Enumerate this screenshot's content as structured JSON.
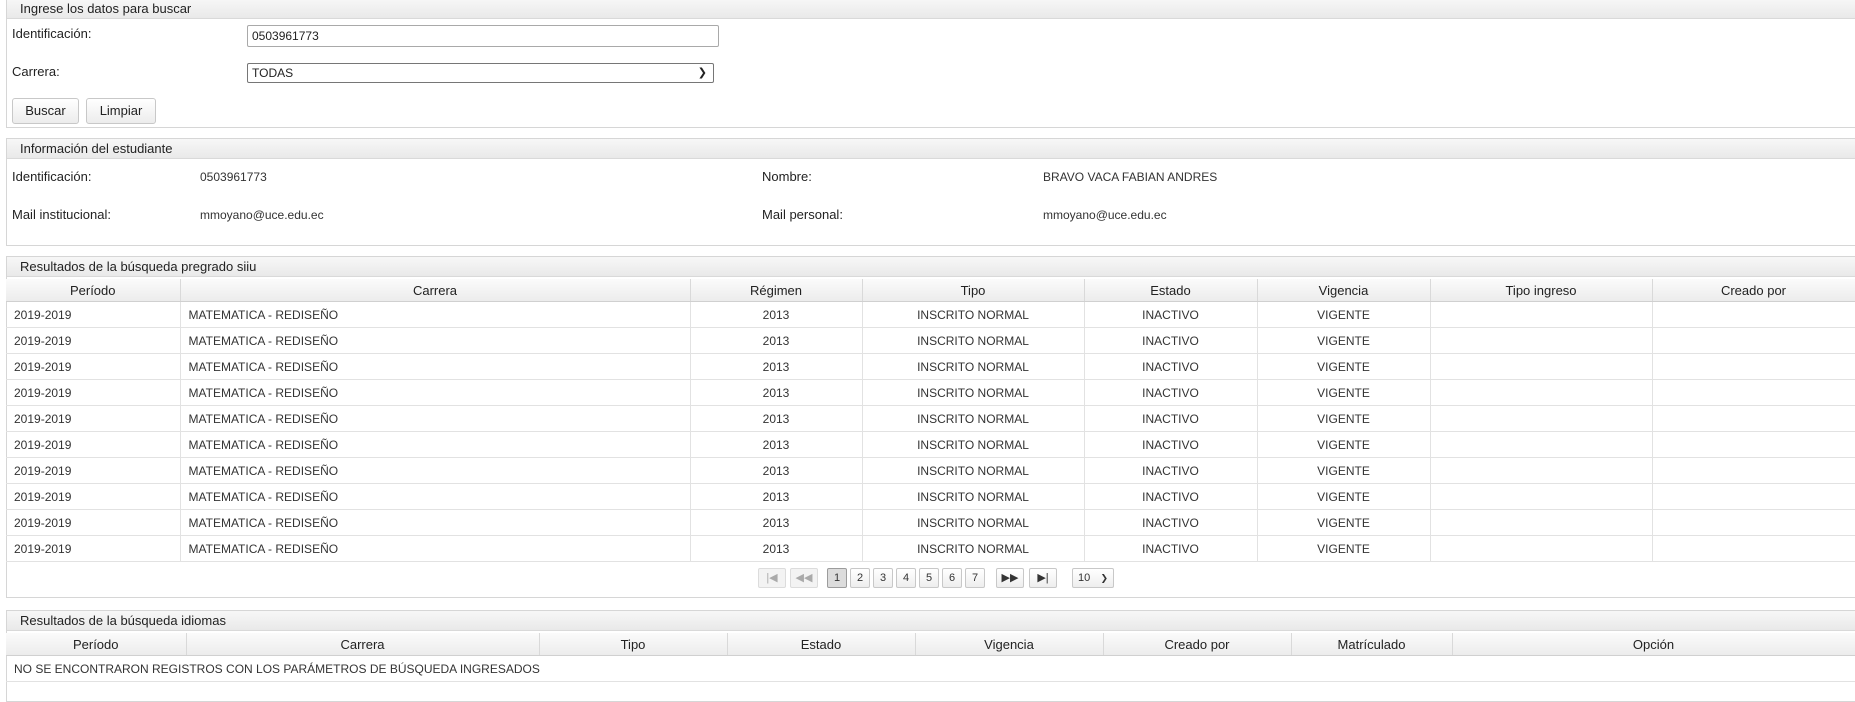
{
  "search": {
    "header": "Ingrese los datos para buscar",
    "id_label": "Identificación:",
    "id_value": "0503961773",
    "carrera_label": "Carrera:",
    "carrera_value": "TODAS",
    "buscar_label": "Buscar",
    "limpiar_label": "Limpiar"
  },
  "student": {
    "header": "Información del estudiante",
    "id_label": "Identificación:",
    "id_value": "0503961773",
    "nombre_label": "Nombre:",
    "nombre_value": "BRAVO VACA FABIAN ANDRES",
    "mail_inst_label": "Mail institucional:",
    "mail_inst_value": "mmoyano@uce.edu.ec",
    "mail_pers_label": "Mail personal:",
    "mail_pers_value": "mmoyano@uce.edu.ec"
  },
  "pregrado": {
    "header": "Resultados de la búsqueda pregrado siiu",
    "columns": [
      "Período",
      "Carrera",
      "Régimen",
      "Tipo",
      "Estado",
      "Vigencia",
      "Tipo ingreso",
      "Creado por"
    ],
    "rows": [
      [
        "2019-2019",
        "MATEMATICA - REDISEÑO",
        "2013",
        "INSCRITO NORMAL",
        "INACTIVO",
        "VIGENTE",
        "",
        ""
      ],
      [
        "2019-2019",
        "MATEMATICA - REDISEÑO",
        "2013",
        "INSCRITO NORMAL",
        "INACTIVO",
        "VIGENTE",
        "",
        ""
      ],
      [
        "2019-2019",
        "MATEMATICA - REDISEÑO",
        "2013",
        "INSCRITO NORMAL",
        "INACTIVO",
        "VIGENTE",
        "",
        ""
      ],
      [
        "2019-2019",
        "MATEMATICA - REDISEÑO",
        "2013",
        "INSCRITO NORMAL",
        "INACTIVO",
        "VIGENTE",
        "",
        ""
      ],
      [
        "2019-2019",
        "MATEMATICA - REDISEÑO",
        "2013",
        "INSCRITO NORMAL",
        "INACTIVO",
        "VIGENTE",
        "",
        ""
      ],
      [
        "2019-2019",
        "MATEMATICA - REDISEÑO",
        "2013",
        "INSCRITO NORMAL",
        "INACTIVO",
        "VIGENTE",
        "",
        ""
      ],
      [
        "2019-2019",
        "MATEMATICA - REDISEÑO",
        "2013",
        "INSCRITO NORMAL",
        "INACTIVO",
        "VIGENTE",
        "",
        ""
      ],
      [
        "2019-2019",
        "MATEMATICA - REDISEÑO",
        "2013",
        "INSCRITO NORMAL",
        "INACTIVO",
        "VIGENTE",
        "",
        ""
      ],
      [
        "2019-2019",
        "MATEMATICA - REDISEÑO",
        "2013",
        "INSCRITO NORMAL",
        "INACTIVO",
        "VIGENTE",
        "",
        ""
      ],
      [
        "2019-2019",
        "MATEMATICA - REDISEÑO",
        "2013",
        "INSCRITO NORMAL",
        "INACTIVO",
        "VIGENTE",
        "",
        ""
      ]
    ],
    "pager": {
      "first": "|◀",
      "prev": "◀◀",
      "pages": [
        "1",
        "2",
        "3",
        "4",
        "5",
        "6",
        "7"
      ],
      "current_page": "1",
      "next": "▶▶",
      "last": "▶|",
      "page_size": "10"
    }
  },
  "idiomas": {
    "header": "Resultados de la búsqueda idiomas",
    "columns": [
      "Período",
      "Carrera",
      "Tipo",
      "Estado",
      "Vigencia",
      "Creado por",
      "Matrículado",
      "Opción"
    ],
    "empty_message": "NO SE ENCONTRARON REGISTROS CON LOS PARÁMETROS DE BÚSQUEDA INGRESADOS"
  }
}
